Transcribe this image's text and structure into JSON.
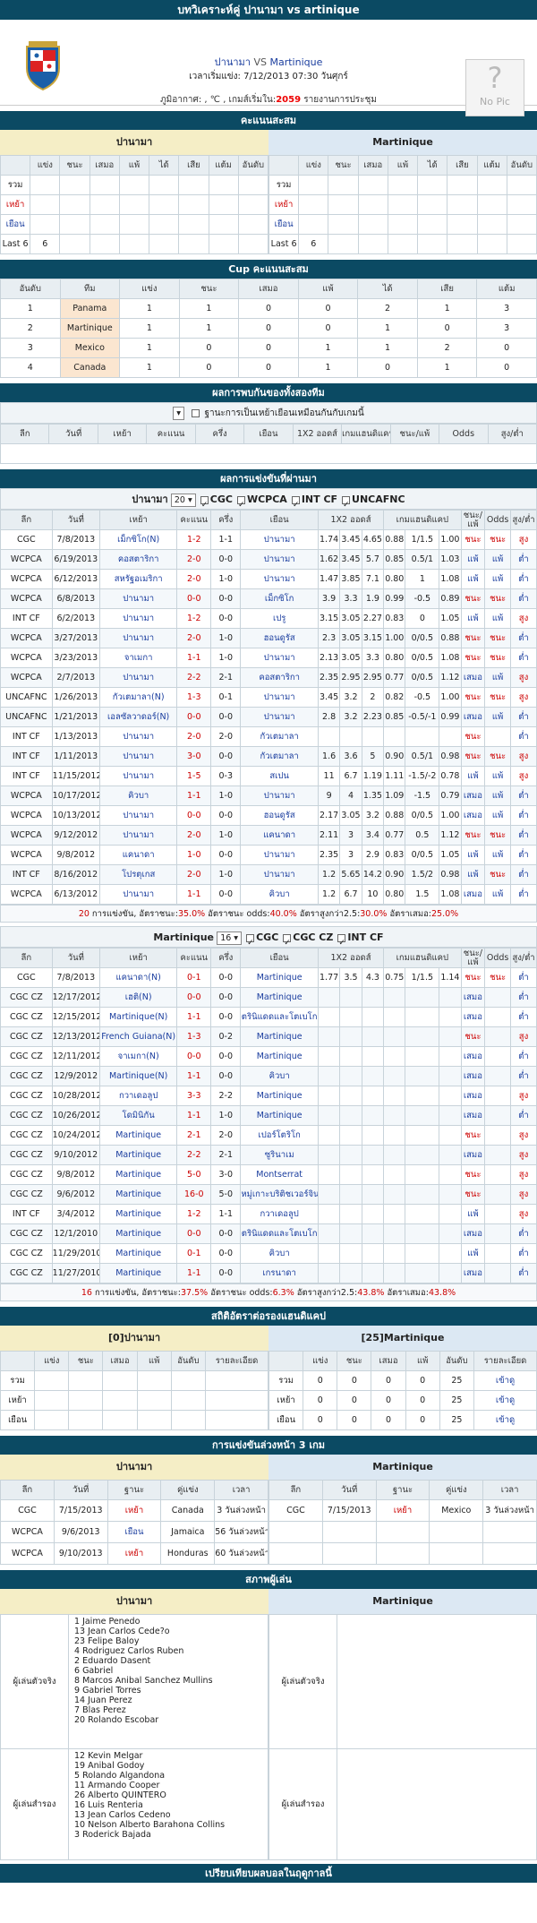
{
  "title": "บทวิเคราะห์คู่ ปานามา vs artinique",
  "header": {
    "home": "ปานามา",
    "vs": "VS",
    "away": "Martinique",
    "time_label": "เวลาเริ่มแข่ง:",
    "time_value": "7/12/2013 07:30 วันศุกร์",
    "weather_prefix": "ภูมิอากาศ: , ℃ , เกมส์เริ่มใน:",
    "countdown": "2059",
    "weather_suffix": "รายงานการประชุม",
    "nopic": "No Pic"
  },
  "standings": {
    "title": "คะแนนสะสม",
    "home": "ปานามา",
    "away": "Martinique",
    "cols": [
      "แข่ง",
      "ชนะ",
      "เสมอ",
      "แพ้",
      "ได้",
      "เสีย",
      "แต้ม",
      "อันดับ"
    ],
    "rows": [
      "รวม",
      "เหย้า",
      "เยือน",
      "Last 6"
    ],
    "last6": "6"
  },
  "cup": {
    "title": "Cup คะแนนสะสม",
    "cols": [
      "อันดับ",
      "ทีม",
      "แข่ง",
      "ชนะ",
      "เสมอ",
      "แพ้",
      "ได้",
      "เสีย",
      "แต้ม"
    ],
    "rows": [
      [
        "1",
        "Panama",
        "1",
        "1",
        "0",
        "0",
        "2",
        "1",
        "3"
      ],
      [
        "2",
        "Martinique",
        "1",
        "1",
        "0",
        "0",
        "1",
        "0",
        "3"
      ],
      [
        "3",
        "Mexico",
        "1",
        "0",
        "0",
        "1",
        "1",
        "2",
        "0"
      ],
      [
        "4",
        "Canada",
        "1",
        "0",
        "0",
        "1",
        "0",
        "1",
        "0"
      ]
    ]
  },
  "h2h": {
    "title": "ผลการพบกันของทั้งสองทีม",
    "option": "ฐานะการเป็นเหย้าเยือนเหมือนกันกับเกมนี้",
    "cols": [
      "ลีก",
      "วันที่",
      "เหย้า",
      "คะแนน",
      "ครึ่ง",
      "เยือน",
      "1X2 ออดส์",
      "เกมแฮนดิแคป",
      "ชนะ/แพ้",
      "Odds",
      "สูง/ต่ำ"
    ]
  },
  "recent": {
    "title": "ผลการแข่งขันที่ผ่านมา",
    "cols": [
      "ลีก",
      "วันที่",
      "เหย้า",
      "คะแนน",
      "ครึ่ง",
      "เยือน",
      "1X2 ออดส์",
      "เกมแฮนดิแคป",
      "ชนะ/แพ้",
      "Odds",
      "สูง/ต่ำ"
    ],
    "home": {
      "team": "ปานามา",
      "count": "20",
      "filters": [
        "CGC",
        "WCPCA",
        "INT CF",
        "UNCAFNC"
      ],
      "rows": [
        [
          "CGC",
          "7/8/2013",
          "เม็กซิโก(N)",
          "1-2",
          "1-1",
          "ปานามา",
          "1.74",
          "3.45",
          "4.65",
          "0.88",
          "1/1.5",
          "1.00",
          "ชนะ",
          "ชนะ",
          "สูง"
        ],
        [
          "WCPCA",
          "6/19/2013",
          "คอสตาริกา",
          "2-0",
          "0-0",
          "ปานามา",
          "1.62",
          "3.45",
          "5.7",
          "0.85",
          "0.5/1",
          "1.03",
          "แพ้",
          "แพ้",
          "ต่ำ"
        ],
        [
          "WCPCA",
          "6/12/2013",
          "สหรัฐอเมริกา",
          "2-0",
          "1-0",
          "ปานามา",
          "1.47",
          "3.85",
          "7.1",
          "0.80",
          "1",
          "1.08",
          "แพ้",
          "แพ้",
          "ต่ำ"
        ],
        [
          "WCPCA",
          "6/8/2013",
          "ปานามา",
          "0-0",
          "0-0",
          "เม็กซิโก",
          "3.9",
          "3.3",
          "1.9",
          "0.99",
          "-0.5",
          "0.89",
          "ชนะ",
          "ชนะ",
          "ต่ำ"
        ],
        [
          "INT CF",
          "6/2/2013",
          "ปานามา",
          "1-2",
          "0-0",
          "เปรู",
          "3.15",
          "3.05",
          "2.27",
          "0.83",
          "0",
          "1.05",
          "แพ้",
          "แพ้",
          "สูง"
        ],
        [
          "WCPCA",
          "3/27/2013",
          "ปานามา",
          "2-0",
          "1-0",
          "ฮอนดูรัส",
          "2.3",
          "3.05",
          "3.15",
          "1.00",
          "0/0.5",
          "0.88",
          "ชนะ",
          "ชนะ",
          "ต่ำ"
        ],
        [
          "WCPCA",
          "3/23/2013",
          "จาเมกา",
          "1-1",
          "1-0",
          "ปานามา",
          "2.13",
          "3.05",
          "3.3",
          "0.80",
          "0/0.5",
          "1.08",
          "ชนะ",
          "ชนะ",
          "ต่ำ"
        ],
        [
          "WCPCA",
          "2/7/2013",
          "ปานามา",
          "2-2",
          "2-1",
          "คอสตาริกา",
          "2.35",
          "2.95",
          "2.95",
          "0.77",
          "0/0.5",
          "1.12",
          "เสมอ",
          "แพ้",
          "สูง"
        ],
        [
          "UNCAFNC",
          "1/26/2013",
          "กัวเตมาลา(N)",
          "1-3",
          "0-1",
          "ปานามา",
          "3.45",
          "3.2",
          "2",
          "0.82",
          "-0.5",
          "1.00",
          "ชนะ",
          "ชนะ",
          "สูง"
        ],
        [
          "UNCAFNC",
          "1/21/2013",
          "เอลซัลวาดอร์(N)",
          "0-0",
          "0-0",
          "ปานามา",
          "2.8",
          "3.2",
          "2.23",
          "0.85",
          "-0.5/-1",
          "0.99",
          "เสมอ",
          "แพ้",
          "ต่ำ"
        ],
        [
          "INT CF",
          "1/13/2013",
          "ปานามา",
          "2-0",
          "2-0",
          "กัวเตมาลา",
          "",
          "",
          "",
          "",
          "",
          "",
          "ชนะ",
          "",
          "ต่ำ"
        ],
        [
          "INT CF",
          "1/11/2013",
          "ปานามา",
          "3-0",
          "0-0",
          "กัวเตมาลา",
          "1.6",
          "3.6",
          "5",
          "0.90",
          "0.5/1",
          "0.98",
          "ชนะ",
          "ชนะ",
          "สูง"
        ],
        [
          "INT CF",
          "11/15/2012",
          "ปานามา",
          "1-5",
          "0-3",
          "สเปน",
          "11",
          "6.7",
          "1.19",
          "1.11",
          "-1.5/-2",
          "0.78",
          "แพ้",
          "แพ้",
          "สูง"
        ],
        [
          "WCPCA",
          "10/17/2012",
          "คิวบา",
          "1-1",
          "1-0",
          "ปานามา",
          "9",
          "4",
          "1.35",
          "1.09",
          "-1.5",
          "0.79",
          "เสมอ",
          "แพ้",
          "ต่ำ"
        ],
        [
          "WCPCA",
          "10/13/2012",
          "ปานามา",
          "0-0",
          "0-0",
          "ฮอนดูรัส",
          "2.17",
          "3.05",
          "3.2",
          "0.88",
          "0/0.5",
          "1.00",
          "เสมอ",
          "แพ้",
          "ต่ำ"
        ],
        [
          "WCPCA",
          "9/12/2012",
          "ปานามา",
          "2-0",
          "1-0",
          "แคนาดา",
          "2.11",
          "3",
          "3.4",
          "0.77",
          "0.5",
          "1.12",
          "ชนะ",
          "ชนะ",
          "ต่ำ"
        ],
        [
          "WCPCA",
          "9/8/2012",
          "แคนาดา",
          "1-0",
          "0-0",
          "ปานามา",
          "2.35",
          "3",
          "2.9",
          "0.83",
          "0/0.5",
          "1.05",
          "แพ้",
          "แพ้",
          "ต่ำ"
        ],
        [
          "INT CF",
          "8/16/2012",
          "โปรตุเกส",
          "2-0",
          "1-0",
          "ปานามา",
          "1.2",
          "5.65",
          "14.2",
          "0.90",
          "1.5/2",
          "0.98",
          "แพ้",
          "ชนะ",
          "ต่ำ"
        ],
        [
          "WCPCA",
          "6/13/2012",
          "ปานามา",
          "1-1",
          "0-0",
          "คิวบา",
          "1.2",
          "6.7",
          "10",
          "0.80",
          "1.5",
          "1.08",
          "เสมอ",
          "แพ้",
          "ต่ำ"
        ]
      ],
      "summary": {
        "prefix": "20",
        "text1": " การแข่งขัน, อัตราชนะ:",
        "win": "35.0%",
        "text2": " อัตราชนะ odds:",
        "odds": "40.0%",
        "text3": " อัตราสูงกว่า2.5:",
        "over": "30.0%",
        "text4": " อัตราเสมอ:",
        "draw": "25.0%"
      }
    },
    "away": {
      "team": "Martinique",
      "count": "16",
      "filters": [
        "CGC",
        "CGC CZ",
        "INT CF"
      ],
      "rows": [
        [
          "CGC",
          "7/8/2013",
          "แคนาดา(N)",
          "0-1",
          "0-0",
          "Martinique",
          "1.77",
          "3.5",
          "4.3",
          "0.75",
          "1/1.5",
          "1.14",
          "ชนะ",
          "ชนะ",
          "ต่ำ"
        ],
        [
          "CGC CZ",
          "12/17/2012",
          "เฮติ(N)",
          "0-0",
          "0-0",
          "Martinique",
          "",
          "",
          "",
          "",
          "",
          "",
          "เสมอ",
          "",
          "ต่ำ"
        ],
        [
          "CGC CZ",
          "12/15/2012",
          "Martinique(N)",
          "1-1",
          "0-0",
          "ตรินิแดดและโตเบโก",
          "",
          "",
          "",
          "",
          "",
          "",
          "เสมอ",
          "",
          "ต่ำ"
        ],
        [
          "CGC CZ",
          "12/13/2012",
          "French Guiana(N)",
          "1-3",
          "0-2",
          "Martinique",
          "",
          "",
          "",
          "",
          "",
          "",
          "ชนะ",
          "",
          "สูง"
        ],
        [
          "CGC CZ",
          "12/11/2012",
          "จาเมกา(N)",
          "0-0",
          "0-0",
          "Martinique",
          "",
          "",
          "",
          "",
          "",
          "",
          "เสมอ",
          "",
          "ต่ำ"
        ],
        [
          "CGC CZ",
          "12/9/2012",
          "Martinique(N)",
          "1-1",
          "0-0",
          "คิวบา",
          "",
          "",
          "",
          "",
          "",
          "",
          "เสมอ",
          "",
          "ต่ำ"
        ],
        [
          "CGC CZ",
          "10/28/2012",
          "กวาเดอลูป",
          "3-3",
          "2-2",
          "Martinique",
          "",
          "",
          "",
          "",
          "",
          "",
          "เสมอ",
          "",
          "สูง"
        ],
        [
          "CGC CZ",
          "10/26/2012",
          "โดมินิกัน",
          "1-1",
          "1-0",
          "Martinique",
          "",
          "",
          "",
          "",
          "",
          "",
          "เสมอ",
          "",
          "ต่ำ"
        ],
        [
          "CGC CZ",
          "10/24/2012",
          "Martinique",
          "2-1",
          "2-0",
          "เปอร์โตริโก",
          "",
          "",
          "",
          "",
          "",
          "",
          "ชนะ",
          "",
          "สูง"
        ],
        [
          "CGC CZ",
          "9/10/2012",
          "Martinique",
          "2-2",
          "2-1",
          "ซูรินาเม",
          "",
          "",
          "",
          "",
          "",
          "",
          "เสมอ",
          "",
          "สูง"
        ],
        [
          "CGC CZ",
          "9/8/2012",
          "Martinique",
          "5-0",
          "3-0",
          "Montserrat",
          "",
          "",
          "",
          "",
          "",
          "",
          "ชนะ",
          "",
          "สูง"
        ],
        [
          "CGC CZ",
          "9/6/2012",
          "Martinique",
          "16-0",
          "5-0",
          "หมู่เกาะบริติชเวอร์จิน",
          "",
          "",
          "",
          "",
          "",
          "",
          "ชนะ",
          "",
          "สูง"
        ],
        [
          "INT CF",
          "3/4/2012",
          "Martinique",
          "1-2",
          "1-1",
          "กวาเดอลูป",
          "",
          "",
          "",
          "",
          "",
          "",
          "แพ้",
          "",
          "สูง"
        ],
        [
          "CGC CZ",
          "12/1/2010",
          "Martinique",
          "0-0",
          "0-0",
          "ตรินิแดดและโตเบโก",
          "",
          "",
          "",
          "",
          "",
          "",
          "เสมอ",
          "",
          "ต่ำ"
        ],
        [
          "CGC CZ",
          "11/29/2010",
          "Martinique",
          "0-1",
          "0-0",
          "คิวบา",
          "",
          "",
          "",
          "",
          "",
          "",
          "แพ้",
          "",
          "ต่ำ"
        ],
        [
          "CGC CZ",
          "11/27/2010",
          "Martinique",
          "1-1",
          "0-0",
          "เกรนาดา",
          "",
          "",
          "",
          "",
          "",
          "",
          "เสมอ",
          "",
          "ต่ำ"
        ]
      ],
      "summary": {
        "prefix": "16",
        "text1": " การแข่งขัน, อัตราชนะ:",
        "win": "37.5%",
        "text2": " อัตราชนะ odds:",
        "odds": "6.3%",
        "text3": " อัตราสูงกว่า2.5:",
        "over": "43.8%",
        "text4": " อัตราเสมอ:",
        "draw": "43.8%"
      }
    }
  },
  "handicap": {
    "title": "สถิติอัตราต่อรองแฮนดิแคป",
    "home": "[0]ปานามา",
    "away": "[25]Martinique",
    "cols": [
      "แข่ง",
      "ชนะ",
      "เสมอ",
      "แพ้",
      "อันดับ",
      "รายละเอียด"
    ],
    "rows": [
      "รวม",
      "เหย้า",
      "เยือน"
    ],
    "away_rows": [
      [
        "รวม",
        "0",
        "0",
        "0",
        "0",
        "25",
        "เข้าดู"
      ],
      [
        "เหย้า",
        "0",
        "0",
        "0",
        "0",
        "25",
        "เข้าดู"
      ],
      [
        "เยือน",
        "0",
        "0",
        "0",
        "0",
        "25",
        "เข้าดู"
      ]
    ]
  },
  "next": {
    "title": "การแข่งขันล่วงหน้า 3 เกม",
    "home": "ปานามา",
    "away": "Martinique",
    "cols": [
      "ลีก",
      "วันที่",
      "ฐานะ",
      "คู่แข่ง",
      "เวลา"
    ],
    "home_rows": [
      [
        "CGC",
        "7/15/2013",
        "เหย้า",
        "Canada",
        "3 วันล่วงหน้า"
      ],
      [
        "WCPCA",
        "9/6/2013",
        "เยือน",
        "Jamaica",
        "56 วันล่วงหน้า"
      ],
      [
        "WCPCA",
        "9/10/2013",
        "เหย้า",
        "Honduras",
        "60 วันล่วงหน้า"
      ]
    ],
    "away_rows": [
      [
        "CGC",
        "7/15/2013",
        "เหย้า",
        "Mexico",
        "3 วันล่วงหน้า"
      ]
    ]
  },
  "lineup": {
    "title": "สภาพผู้เล่น",
    "home": "ปานามา",
    "away": "Martinique",
    "starter_label": "ผู้เล่นตัวจริง",
    "sub_label": "ผู้เล่นสำรอง",
    "home_starters": [
      "1 Jaime Penedo",
      "13 Jean Carlos Cede?o",
      "23 Felipe Baloy",
      "4 Rodriguez Carlos Ruben",
      "2 Eduardo Dasent",
      "6 Gabriel",
      "8 Marcos Anibal Sanchez Mullins",
      "9 Gabriel Torres",
      "14 Juan Perez",
      "7 Blas Perez",
      "20 Rolando Escobar"
    ],
    "home_subs": [
      "12 Kevin Melgar",
      "19 Anibal Godoy",
      "5 Rolando Algandona",
      "11 Armando Cooper",
      "26 Alberto QUINTERO",
      "16 Luis Renteria",
      "13 Jean Carlos Cedeno",
      "10 Nelson Alberto Barahona Collins",
      "3 Roderick Bajada"
    ]
  },
  "footer": {
    "title": "เปรียบเทียบผลบอลในฤดูกาลนี้"
  }
}
